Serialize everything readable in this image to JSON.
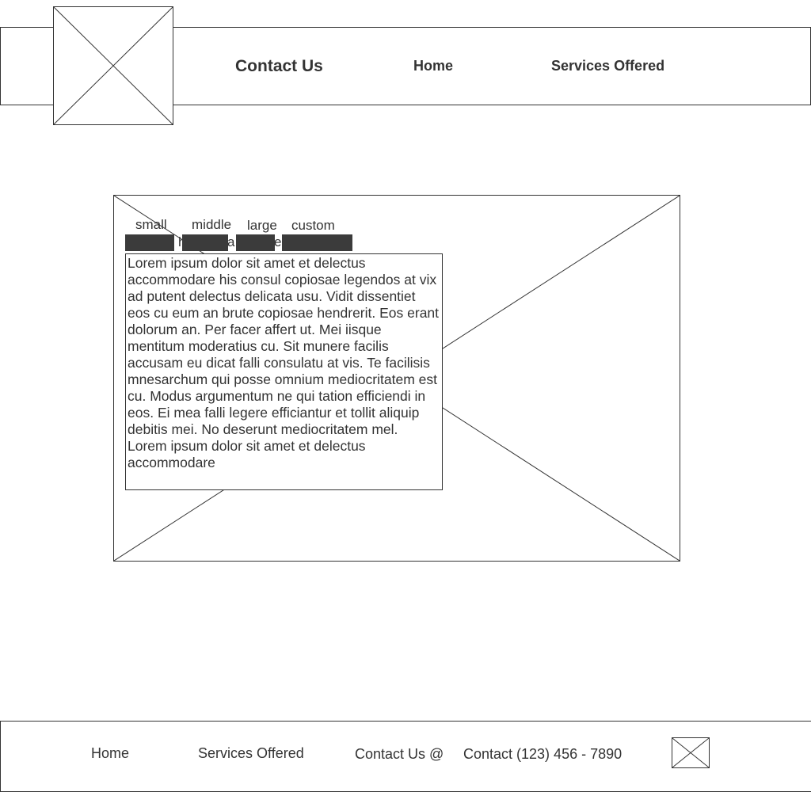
{
  "header": {
    "title": "Contact Us",
    "nav": [
      "Home",
      "Services Offered"
    ],
    "logo": "logo-image-placeholder"
  },
  "main": {
    "tabs": [
      "small",
      "middle",
      "large",
      "custom"
    ],
    "hidden_partial_text": [
      "h",
      "a",
      "e"
    ],
    "body_text": "Lorem ipsum dolor sit amet et delectus accommodare his consul copiosae legendos at vix ad putent delectus delicata usu. Vidit dissentiet eos cu eum an brute copiosae hendrerit. Eos erant dolorum an. Per facer affert ut. Mei iisque mentitum moderatius cu. Sit munere facilis accusam eu dicat falli consulatu at vis. Te facilisis mnesarchum qui posse omnium mediocritatem est cu. Modus argumentum ne qui tation efficiendi in eos. Ei mea falli legere efficiantur et tollit aliquip debitis mei. No deserunt mediocritatem mel. Lorem ipsum dolor sit amet et delectus accommodare"
  },
  "footer": {
    "home": "Home",
    "services": "Services Offered",
    "contact_prefix": "Contact Us @",
    "contact_phone": "Contact (123) 456 - 7890"
  }
}
